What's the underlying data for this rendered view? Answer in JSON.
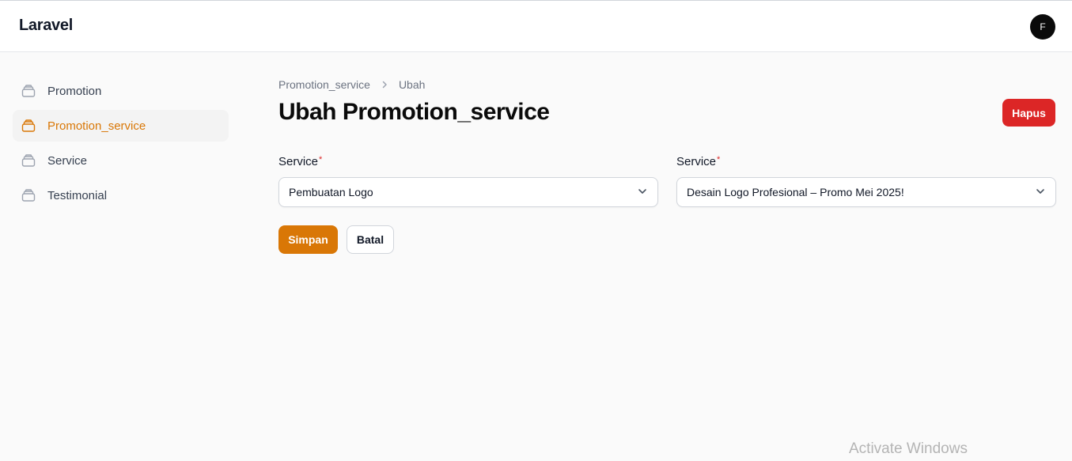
{
  "header": {
    "brand": "Laravel",
    "avatar_initial": "F"
  },
  "sidebar": {
    "items": [
      {
        "label": "Promotion",
        "icon": "stack-icon",
        "active": false
      },
      {
        "label": "Promotion_service",
        "icon": "stack-icon",
        "active": true
      },
      {
        "label": "Service",
        "icon": "stack-icon",
        "active": false
      },
      {
        "label": "Testimonial",
        "icon": "stack-icon",
        "active": false
      }
    ]
  },
  "breadcrumb": {
    "parent": "Promotion_service",
    "current": "Ubah"
  },
  "page": {
    "title": "Ubah Promotion_service",
    "delete_label": "Hapus"
  },
  "form": {
    "fields": [
      {
        "label": "Service",
        "required_mark": "*",
        "value": "Pembuatan Logo"
      },
      {
        "label": "Service",
        "required_mark": "*",
        "value": "Desain Logo Profesional – Promo Mei 2025!"
      }
    ],
    "save_label": "Simpan",
    "cancel_label": "Batal"
  },
  "overlay": {
    "watermark": "Activate Windows"
  },
  "colors": {
    "accent": "#d97706",
    "danger": "#dc2626"
  }
}
